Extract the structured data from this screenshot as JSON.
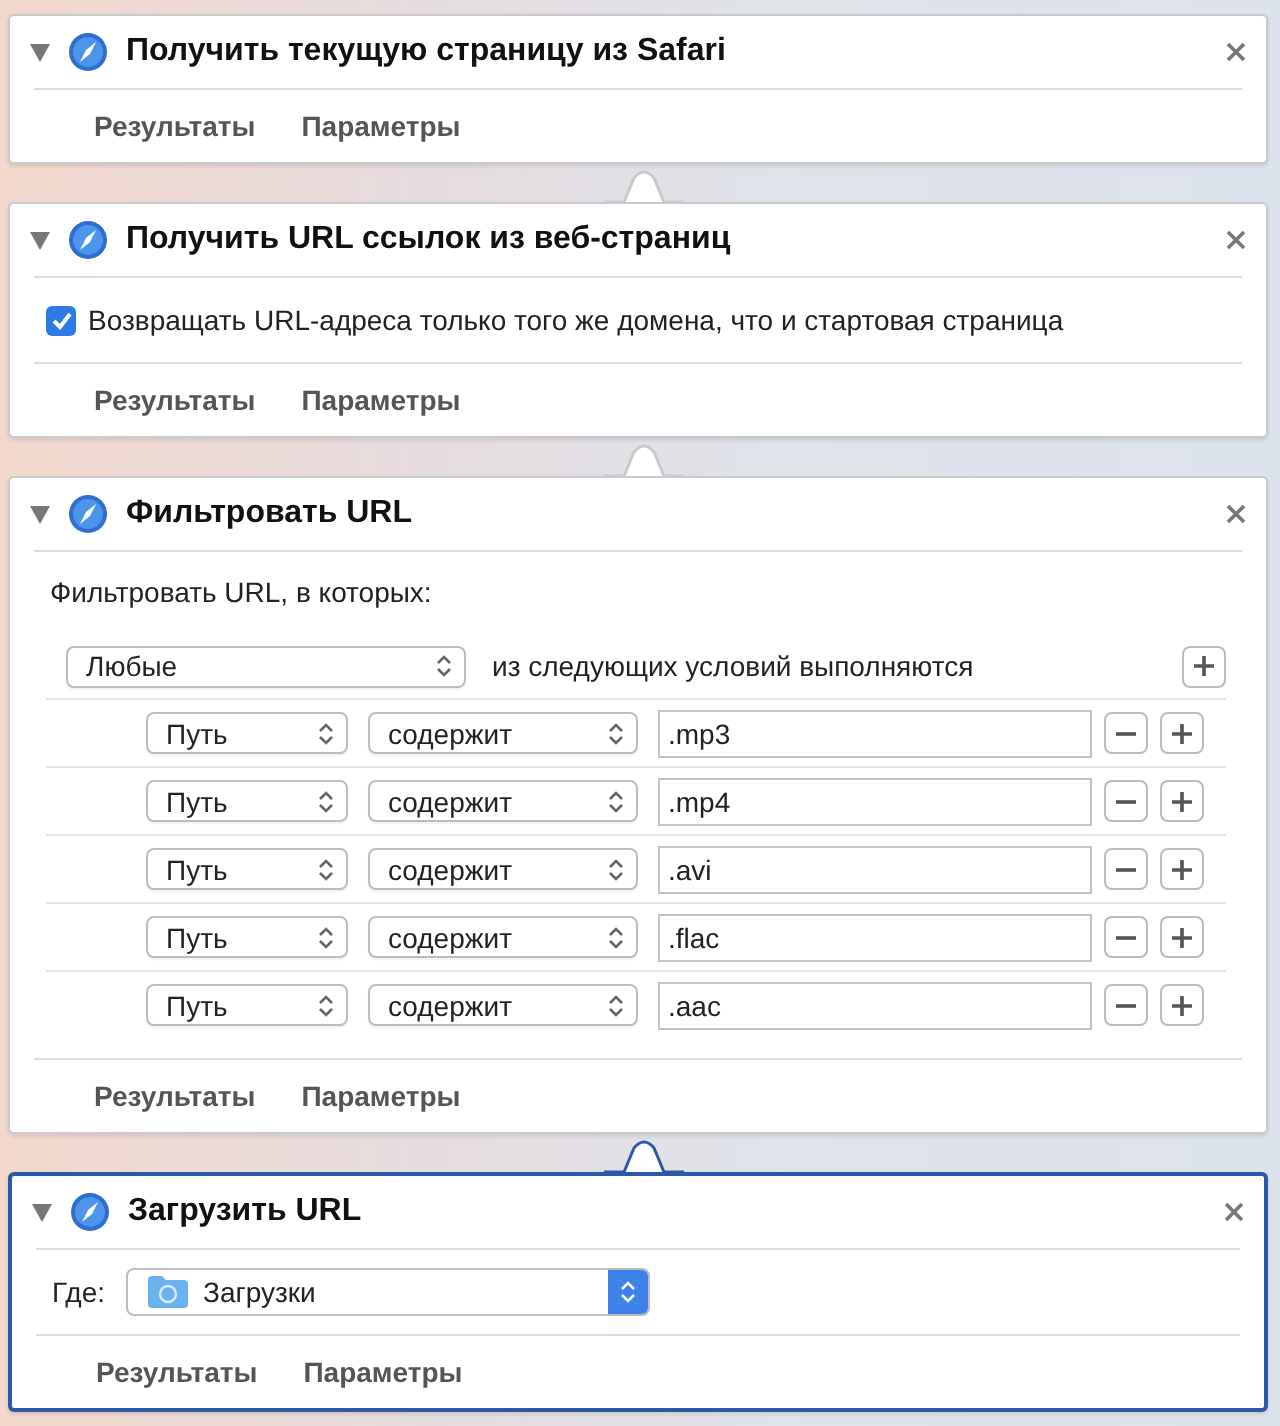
{
  "actions": [
    {
      "kind": "plain",
      "title": "Получить текущую страницу из Safari",
      "selected": false,
      "footer": [
        "Результаты",
        "Параметры"
      ]
    },
    {
      "kind": "checkbox",
      "title": "Получить URL ссылок из веб-страниц",
      "selected": false,
      "option": {
        "label": "Возвращать URL-адреса только того же домена, что и стартовая страница",
        "checked": true
      },
      "footer": [
        "Результаты",
        "Параметры"
      ]
    },
    {
      "kind": "filter",
      "title": "Фильтровать URL",
      "selected": false,
      "filter": {
        "label": "Фильтровать URL, в которых:",
        "match": "Любые",
        "match_text": "из следующих условий выполняются",
        "conditions": [
          {
            "field": "Путь",
            "operator": "содержит",
            "value": ".mp3"
          },
          {
            "field": "Путь",
            "operator": "содержит",
            "value": ".mp4"
          },
          {
            "field": "Путь",
            "operator": "содержит",
            "value": ".avi"
          },
          {
            "field": "Путь",
            "operator": "содержит",
            "value": ".flac"
          },
          {
            "field": "Путь",
            "operator": "содержит",
            "value": ".aac"
          }
        ]
      },
      "footer": [
        "Результаты",
        "Параметры"
      ]
    },
    {
      "kind": "folder",
      "title": "Загрузить URL",
      "selected": true,
      "destination": {
        "label": "Где:",
        "folder": "Загрузки"
      },
      "footer": [
        "Результаты",
        "Параметры"
      ]
    }
  ]
}
